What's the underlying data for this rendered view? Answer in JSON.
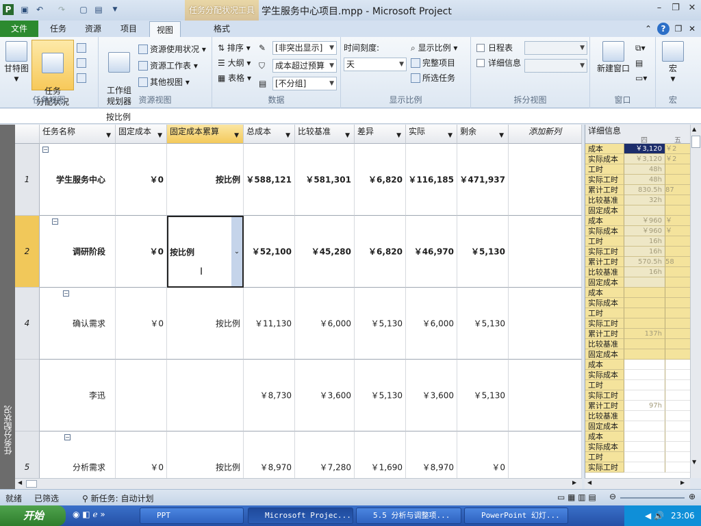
{
  "app": {
    "contextual_tab": "任务分配状况工具",
    "title": "学生服务中心项目.mpp  -  Microsoft Project"
  },
  "tabs": [
    "文件",
    "任务",
    "资源",
    "项目",
    "视图",
    "格式"
  ],
  "ribbon": {
    "task_views": {
      "gantt": "甘特图",
      "usage": "任务\n分配状况",
      "label": "任务视图"
    },
    "resource_views": {
      "planner": "工作组\n规划器",
      "usage": "资源使用状况",
      "sheet": "资源工作表",
      "other": "其他视图",
      "label": "资源视图"
    },
    "data": {
      "sort": "排序",
      "outline": "大纲",
      "tables": "表格",
      "highlight": "[非突出显示]",
      "filter": "成本超过预算",
      "group": "[不分组]",
      "label": "数据"
    },
    "zoom": {
      "timescale_label": "时间刻度:",
      "timescale_value": "天",
      "zoom": "显示比例",
      "entire": "完整项目",
      "selected": "所选任务",
      "label": "显示比例"
    },
    "split": {
      "timeline": "日程表",
      "details": "详细信息",
      "label": "拆分视图"
    },
    "window": {
      "new": "新建窗口",
      "label": "窗口"
    },
    "macro": {
      "macros": "宏",
      "label": "宏"
    }
  },
  "formula_bar": "按比例",
  "view_bar": "任务分配状况",
  "grid": {
    "headers": [
      "任务名称",
      "固定成本",
      "固定成本累算",
      "总成本",
      "比较基准",
      "差异",
      "实际",
      "剩余",
      "添加新列"
    ],
    "rows": [
      {
        "id": "1",
        "name": "学生服务中心",
        "fixed": "￥0",
        "accrue": "按比例",
        "total": "￥588,121",
        "baseline": "￥581,301",
        "variance": "￥6,820",
        "actual": "￥116,185",
        "remaining": "￥471,937"
      },
      {
        "id": "2",
        "name": "调研阶段",
        "fixed": "￥0",
        "accrue": "按比例",
        "total": "￥52,100",
        "baseline": "￥45,280",
        "variance": "￥6,820",
        "actual": "￥46,970",
        "remaining": "￥5,130"
      },
      {
        "id": "4",
        "name": "确认需求",
        "fixed": "￥0",
        "accrue": "按比例",
        "total": "￥11,130",
        "baseline": "￥6,000",
        "variance": "￥5,130",
        "actual": "￥6,000",
        "remaining": "￥5,130"
      },
      {
        "id": "",
        "name": "李迅",
        "fixed": "",
        "accrue": "",
        "total": "￥8,730",
        "baseline": "￥3,600",
        "variance": "￥5,130",
        "actual": "￥3,600",
        "remaining": "￥5,130"
      },
      {
        "id": "5",
        "name": "分析需求",
        "fixed": "￥0",
        "accrue": "按比例",
        "total": "￥8,970",
        "baseline": "￥7,280",
        "variance": "￥1,690",
        "actual": "￥8,970",
        "remaining": "￥0"
      }
    ]
  },
  "details": {
    "header": "详细信息",
    "day1": "四",
    "day2": "五",
    "rows": [
      {
        "label": "成本",
        "v1": "￥3,120",
        "v2": "￥2"
      },
      {
        "label": "实际成本",
        "v1": "￥3,120",
        "v2": "￥2"
      },
      {
        "label": "工时",
        "v1": "48h",
        "v2": ""
      },
      {
        "label": "实际工时",
        "v1": "48h",
        "v2": ""
      },
      {
        "label": "累计工时",
        "v1": "830.5h",
        "v2": "87"
      },
      {
        "label": "比较基准",
        "v1": "32h",
        "v2": ""
      },
      {
        "label": "固定成本",
        "v1": "",
        "v2": ""
      },
      {
        "label": "成本",
        "v1": "￥960",
        "v2": "￥"
      },
      {
        "label": "实际成本",
        "v1": "￥960",
        "v2": "￥"
      },
      {
        "label": "工时",
        "v1": "16h",
        "v2": ""
      },
      {
        "label": "实际工时",
        "v1": "16h",
        "v2": ""
      },
      {
        "label": "累计工时",
        "v1": "570.5h",
        "v2": "58"
      },
      {
        "label": "比较基准",
        "v1": "16h",
        "v2": ""
      },
      {
        "label": "固定成本",
        "v1": "",
        "v2": ""
      },
      {
        "label": "成本",
        "v1": "",
        "v2": ""
      },
      {
        "label": "实际成本",
        "v1": "",
        "v2": ""
      },
      {
        "label": "工时",
        "v1": "",
        "v2": ""
      },
      {
        "label": "实际工时",
        "v1": "",
        "v2": ""
      },
      {
        "label": "累计工时",
        "v1": "137h",
        "v2": ""
      },
      {
        "label": "比较基准",
        "v1": "",
        "v2": ""
      },
      {
        "label": "固定成本",
        "v1": "",
        "v2": ""
      },
      {
        "label": "成本",
        "v1": "",
        "v2": ""
      },
      {
        "label": "实际成本",
        "v1": "",
        "v2": ""
      },
      {
        "label": "工时",
        "v1": "",
        "v2": ""
      },
      {
        "label": "实际工时",
        "v1": "",
        "v2": ""
      },
      {
        "label": "累计工时",
        "v1": "97h",
        "v2": ""
      },
      {
        "label": "比较基准",
        "v1": "",
        "v2": ""
      },
      {
        "label": "固定成本",
        "v1": "",
        "v2": ""
      },
      {
        "label": "成本",
        "v1": "",
        "v2": ""
      },
      {
        "label": "实际成本",
        "v1": "",
        "v2": ""
      },
      {
        "label": "工时",
        "v1": "",
        "v2": ""
      },
      {
        "label": "实际工时",
        "v1": "",
        "v2": ""
      }
    ]
  },
  "status": {
    "ready": "就绪",
    "filtered": "已筛选",
    "new_task": "新任务: 自动计划"
  },
  "taskbar": {
    "start": "开始",
    "items": [
      "PPT",
      "Microsoft Projec...",
      "5.5 分析与调整项...",
      "PowerPoint 幻灯..."
    ],
    "clock": "23:06"
  },
  "colors": {
    "file_tab": "#2c8a2f",
    "selected_row": "#f1c85a",
    "detail_bg": "#f4e39c",
    "taskbar": "#2450a6"
  }
}
